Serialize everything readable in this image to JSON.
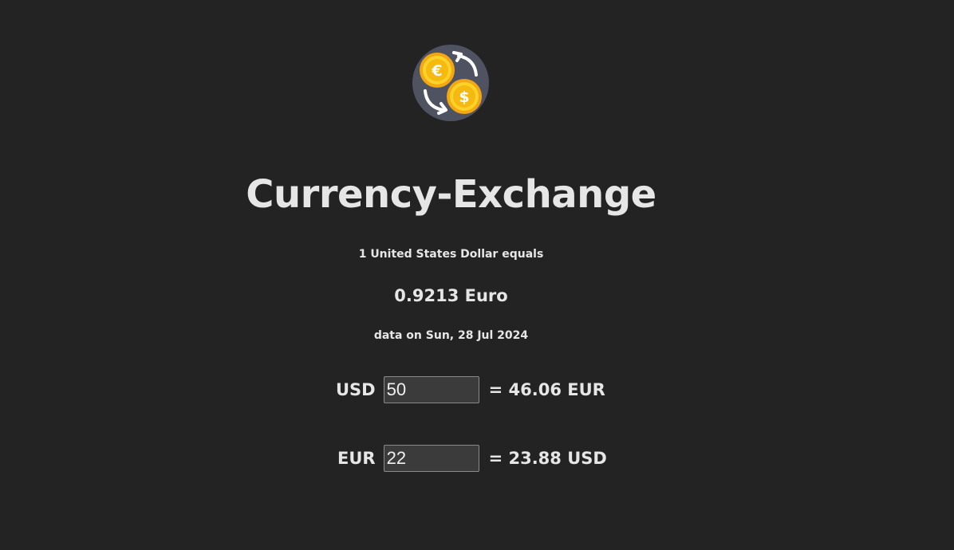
{
  "app": {
    "title": "Currency-Exchange"
  },
  "summary": {
    "equals_text": "1 United States Dollar equals",
    "rate_text": "0.9213 Euro",
    "date_text": "data on Sun, 28 Jul 2024"
  },
  "converters": [
    {
      "code": "USD",
      "value": "50",
      "result": "= 46.06 EUR"
    },
    {
      "code": "EUR",
      "value": "22",
      "result": "= 23.88 USD"
    }
  ],
  "icons": {
    "logo": "currency-exchange-icon"
  },
  "colors": {
    "background": "#232323",
    "text": "#e6e6e6",
    "logo_circle": "#4f5260",
    "coin": "#f5c518"
  }
}
